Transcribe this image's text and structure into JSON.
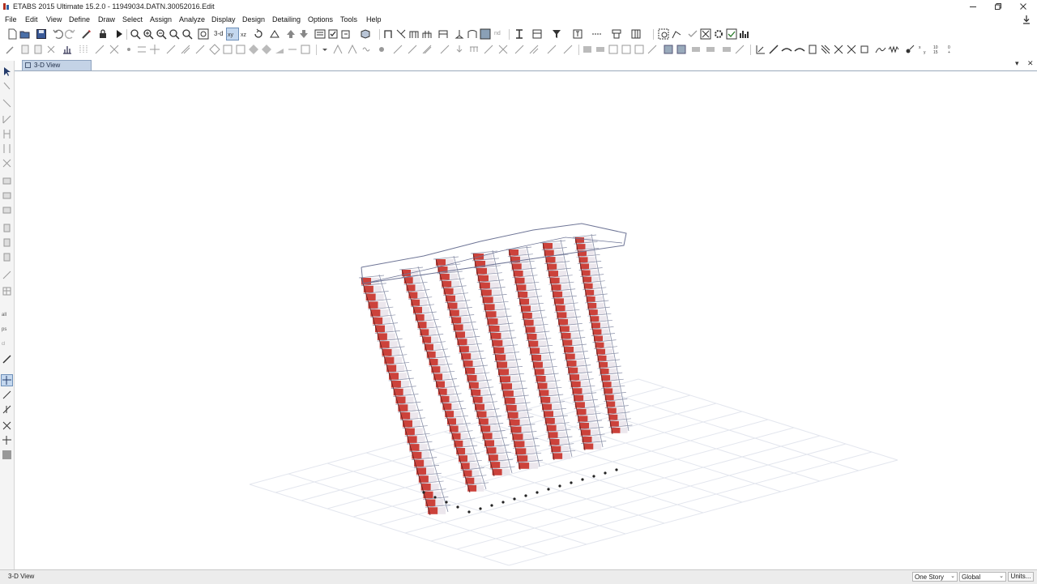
{
  "window": {
    "title": "ETABS 2015 Ultimate 15.2.0 - 11949034.DATN.30052016.Edit",
    "minimize_icon": "minimize-icon",
    "restore_icon": "restore-icon",
    "close_icon": "close-icon"
  },
  "menu": {
    "items": [
      "File",
      "Edit",
      "View",
      "Define",
      "Draw",
      "Select",
      "Assign",
      "Analyze",
      "Display",
      "Design",
      "Detailing",
      "Options",
      "Tools",
      "Help"
    ]
  },
  "toolbar1": {
    "view_3d_label": "3-d",
    "view_plan_label": "nd"
  },
  "view": {
    "tab_label": "3-D View",
    "tab_icon": "model-view-icon"
  },
  "colors": {
    "wall_red": "#c8322a",
    "frame_gray": "#8a90a8",
    "tab_blue": "#c4d3e6",
    "background": "#ffffff"
  },
  "status": {
    "text": "3-D View",
    "story_option": "One Story",
    "coord_option": "Global",
    "units_label": "Units..."
  }
}
